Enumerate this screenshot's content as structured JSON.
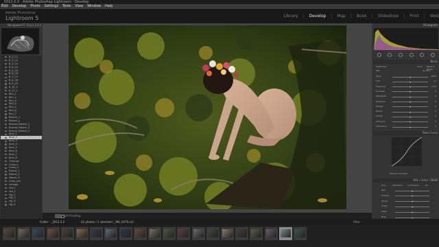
{
  "window": {
    "title": "_2012-2-2 - Adobe Photoshop Lightroom - Develop"
  },
  "menu": [
    "Edit",
    "Develop",
    "Photo",
    "Settings",
    "Tools",
    "View",
    "Window",
    "Help"
  ],
  "brand": {
    "company": "Adobe Photoshop",
    "product": "Lightroom 5"
  },
  "modules": {
    "items": [
      "Library",
      "Develop",
      "Map",
      "Book",
      "Slideshow",
      "Print",
      "Web"
    ],
    "active": "Develop"
  },
  "left_panel": {
    "navigator_label": "Navigator",
    "navigator_zoom": [
      "FIT",
      "FILL",
      "1:1",
      "3:1"
    ],
    "presets": [
      "B_1_C1",
      "B_2_C2",
      "B_3_C3",
      "B_4_C4",
      "B_5_C5",
      "B_6_C6",
      "B_7_C7",
      "B_8_C8",
      "B_9_C9",
      "b_10_1",
      "b_11_1",
      "film_1",
      "film_2",
      "film_3",
      "film_4",
      "film_5",
      "film_6",
      "film_7",
      "Bleach_1",
      "Bleach_2",
      "Bronze_Bleach_1",
      "Bronze_Bleach_2",
      "Bronze_Bleach_3",
      "blue_1",
      "blue_2",
      "blue_3",
      "blue_4",
      "blue_5",
      "blue_6",
      "blue_7",
      "blue_8",
      "Cherries",
      "Cross_1",
      "Cross_2",
      "Dance_1",
      "Dance_2",
      "Dance_3",
      "cross_pro",
      "vintage",
      "red_1",
      "red_2",
      "vig_1",
      "vig_2",
      "vig_3",
      "vig_4"
    ],
    "selected_preset": "blue_2",
    "copy_label": "Copy...",
    "paste_label": "Paste"
  },
  "toolbar": {
    "soft_proofing_label": "Soft Proofing"
  },
  "right_panel": {
    "histogram_label": "Histogram",
    "basic_label": "Basic",
    "tone_curve_label": "Tone Curve",
    "hsl_label": "HSL / Color / B&W",
    "treatment_color": "Color",
    "treatment_bw": "Black & White",
    "wb_label": "WB :",
    "wb_value": "As Shot",
    "basic_sliders": [
      {
        "label": "Temp",
        "value": "4950"
      },
      {
        "label": "Tint",
        "value": "+5"
      },
      {
        "label": "Exposure",
        "value": "0.00"
      },
      {
        "label": "Contrast",
        "value": "0"
      },
      {
        "label": "Highlights",
        "value": "0"
      },
      {
        "label": "Shadows",
        "value": "0"
      },
      {
        "label": "Whites",
        "value": "0"
      },
      {
        "label": "Blacks",
        "value": "0"
      },
      {
        "label": "Clarity",
        "value": "0"
      },
      {
        "label": "Vibrance",
        "value": "0"
      },
      {
        "label": "Saturation",
        "value": "0"
      }
    ],
    "curve_channel": "Medium Contrast",
    "hsl_tabs": [
      "Hue",
      "Saturation",
      "Luminance",
      "All"
    ],
    "hsl_sliders": [
      "Red",
      "Orange",
      "Yellow",
      "Green",
      "Aqua",
      "Blue",
      "Purple",
      "Magenta"
    ],
    "previous_label": "Previous",
    "reset_label": "Reset"
  },
  "filmbar": {
    "folder_label": "Folder : _2012-2-2",
    "count_label": "42 photos / 1 selected / _MG_6479.cr2",
    "filter_label": "Filter :"
  },
  "colors": {
    "accent": "#e8e8e8",
    "panel": "#333333",
    "background": "#444444"
  }
}
